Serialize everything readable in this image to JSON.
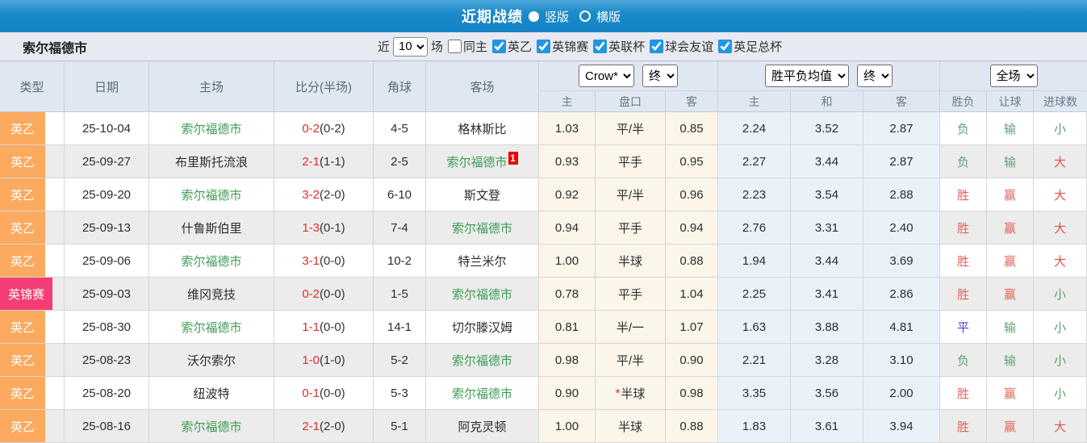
{
  "topbar": {
    "title": "近期战绩",
    "radio_vertical": "竖版",
    "radio_horizontal": "横版"
  },
  "filterbar": {
    "team": "索尔福德市",
    "near_label": "近",
    "near_value": "10",
    "games_label": "场",
    "same_home_label": "同主",
    "same_home_checked": false,
    "leagues": [
      {
        "label": "英乙",
        "checked": true
      },
      {
        "label": "英锦赛",
        "checked": true
      },
      {
        "label": "英联杯",
        "checked": true
      },
      {
        "label": "球会友谊",
        "checked": true
      },
      {
        "label": "英足总杯",
        "checked": true
      }
    ]
  },
  "table": {
    "headers": {
      "type": "类型",
      "date": "日期",
      "home": "主场",
      "score": "比分(半场)",
      "corner": "角球",
      "away": "客场"
    },
    "dropdowns": {
      "company": "Crow*",
      "company_time": "终",
      "avg": "胜平负均值",
      "avg_time": "终",
      "scope": "全场"
    },
    "subheaders": [
      "主",
      "盘口",
      "客",
      "主",
      "和",
      "客",
      "胜负",
      "让球",
      "进球数"
    ],
    "rows": [
      {
        "type": "英乙",
        "date": "25-10-04",
        "home": "索尔福德市",
        "home_self": true,
        "score": "0-2",
        "half": "(0-2)",
        "corner": "4-5",
        "away": "格林斯比",
        "away_self": false,
        "away_badge": "",
        "odds_home": "1.03",
        "handicap": "平/半",
        "handicap_star": false,
        "odds_away": "0.85",
        "avg_home": "2.24",
        "avg_draw": "3.52",
        "avg_away": "2.87",
        "result": "负",
        "result_key": "lose",
        "spread": "输",
        "spread_key": "lose",
        "goals": "小",
        "goals_key": "small"
      },
      {
        "type": "英乙",
        "date": "25-09-27",
        "home": "布里斯托流浪",
        "home_self": false,
        "score": "2-1",
        "half": "(1-1)",
        "corner": "2-5",
        "away": "索尔福德市",
        "away_self": true,
        "away_badge": "1",
        "odds_home": "0.93",
        "handicap": "平手",
        "handicap_star": false,
        "odds_away": "0.95",
        "avg_home": "2.27",
        "avg_draw": "3.44",
        "avg_away": "2.87",
        "result": "负",
        "result_key": "lose",
        "spread": "输",
        "spread_key": "lose",
        "goals": "大",
        "goals_key": "big"
      },
      {
        "type": "英乙",
        "date": "25-09-20",
        "home": "索尔福德市",
        "home_self": true,
        "score": "3-2",
        "half": "(2-0)",
        "corner": "6-10",
        "away": "斯文登",
        "away_self": false,
        "away_badge": "",
        "odds_home": "0.92",
        "handicap": "平/半",
        "handicap_star": false,
        "odds_away": "0.96",
        "avg_home": "2.23",
        "avg_draw": "3.54",
        "avg_away": "2.88",
        "result": "胜",
        "result_key": "win",
        "spread": "赢",
        "spread_key": "win",
        "goals": "大",
        "goals_key": "big"
      },
      {
        "type": "英乙",
        "date": "25-09-13",
        "home": "什鲁斯伯里",
        "home_self": false,
        "score": "1-3",
        "half": "(0-1)",
        "corner": "7-4",
        "away": "索尔福德市",
        "away_self": true,
        "away_badge": "",
        "odds_home": "0.94",
        "handicap": "平手",
        "handicap_star": false,
        "odds_away": "0.94",
        "avg_home": "2.76",
        "avg_draw": "3.31",
        "avg_away": "2.40",
        "result": "胜",
        "result_key": "win",
        "spread": "赢",
        "spread_key": "win",
        "goals": "大",
        "goals_key": "big"
      },
      {
        "type": "英乙",
        "date": "25-09-06",
        "home": "索尔福德市",
        "home_self": true,
        "score": "3-1",
        "half": "(0-0)",
        "corner": "10-2",
        "away": "特兰米尔",
        "away_self": false,
        "away_badge": "",
        "odds_home": "1.00",
        "handicap": "半球",
        "handicap_star": false,
        "odds_away": "0.88",
        "avg_home": "1.94",
        "avg_draw": "3.44",
        "avg_away": "3.69",
        "result": "胜",
        "result_key": "win",
        "spread": "赢",
        "spread_key": "win",
        "goals": "大",
        "goals_key": "big"
      },
      {
        "type": "英锦赛",
        "date": "25-09-03",
        "home": "维冈竞技",
        "home_self": false,
        "score": "0-2",
        "half": "(0-0)",
        "corner": "1-5",
        "away": "索尔福德市",
        "away_self": true,
        "away_badge": "",
        "odds_home": "0.78",
        "handicap": "平手",
        "handicap_star": false,
        "odds_away": "1.04",
        "avg_home": "2.25",
        "avg_draw": "3.41",
        "avg_away": "2.86",
        "result": "胜",
        "result_key": "win",
        "spread": "赢",
        "spread_key": "win",
        "goals": "小",
        "goals_key": "small"
      },
      {
        "type": "英乙",
        "date": "25-08-30",
        "home": "索尔福德市",
        "home_self": true,
        "score": "1-1",
        "half": "(0-0)",
        "corner": "14-1",
        "away": "切尔滕汉姆",
        "away_self": false,
        "away_badge": "",
        "odds_home": "0.81",
        "handicap": "半/一",
        "handicap_star": false,
        "odds_away": "1.07",
        "avg_home": "1.63",
        "avg_draw": "3.88",
        "avg_away": "4.81",
        "result": "平",
        "result_key": "draw",
        "spread": "输",
        "spread_key": "lose",
        "goals": "小",
        "goals_key": "small"
      },
      {
        "type": "英乙",
        "date": "25-08-23",
        "home": "沃尔索尔",
        "home_self": false,
        "score": "1-0",
        "half": "(1-0)",
        "corner": "5-2",
        "away": "索尔福德市",
        "away_self": true,
        "away_badge": "",
        "odds_home": "0.98",
        "handicap": "平/半",
        "handicap_star": false,
        "odds_away": "0.90",
        "avg_home": "2.21",
        "avg_draw": "3.28",
        "avg_away": "3.10",
        "result": "负",
        "result_key": "lose",
        "spread": "输",
        "spread_key": "lose",
        "goals": "小",
        "goals_key": "small"
      },
      {
        "type": "英乙",
        "date": "25-08-20",
        "home": "纽波特",
        "home_self": false,
        "score": "0-1",
        "half": "(0-0)",
        "corner": "5-3",
        "away": "索尔福德市",
        "away_self": true,
        "away_badge": "",
        "odds_home": "0.90",
        "handicap": "半球",
        "handicap_star": true,
        "odds_away": "0.98",
        "avg_home": "3.35",
        "avg_draw": "3.56",
        "avg_away": "2.00",
        "result": "胜",
        "result_key": "win",
        "spread": "赢",
        "spread_key": "win",
        "goals": "小",
        "goals_key": "small"
      },
      {
        "type": "英乙",
        "date": "25-08-16",
        "home": "索尔福德市",
        "home_self": true,
        "score": "2-1",
        "half": "(2-0)",
        "corner": "5-1",
        "away": "阿克灵顿",
        "away_self": false,
        "away_badge": "",
        "odds_home": "1.00",
        "handicap": "半球",
        "handicap_star": false,
        "odds_away": "0.88",
        "avg_home": "1.83",
        "avg_draw": "3.61",
        "avg_away": "3.94",
        "result": "胜",
        "result_key": "win",
        "spread": "赢",
        "spread_key": "win",
        "goals": "大",
        "goals_key": "big"
      }
    ]
  },
  "colors": {
    "type_badge": {
      "英乙": "#fbaa60",
      "英锦赛": "#f43d74"
    },
    "topbar_blue": "#1583c4",
    "team_green": "#3e9b55",
    "score_red": "#e32b2b",
    "win_red": "#e2635c",
    "lose_green": "#63a173",
    "draw_blue": "#4a41d6",
    "cream_col": "#fbf5ea",
    "blue_col": "#eaf2f9"
  }
}
